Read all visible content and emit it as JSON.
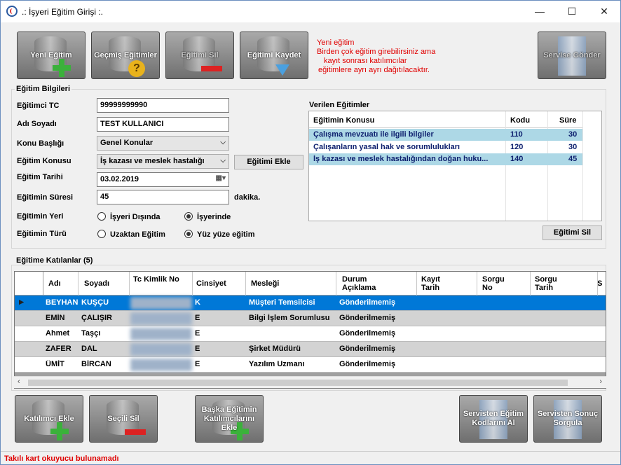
{
  "window": {
    "title": ".: İşyeri Eğitim Girişi :.",
    "minimize_icon": "minimize-icon",
    "maximize_icon": "maximize-icon",
    "close_icon": "close-icon"
  },
  "toolbar": {
    "new_training": "Yeni Eğitim",
    "past_trainings": "Geçmiş Eğitimler",
    "delete_training": "Eğitimi Sil",
    "save_training": "Eğitimi Kaydet",
    "send_service": "Servise Gönder"
  },
  "notice": {
    "line1": "Yeni eğitim",
    "line2": "Birden çok eğitim girebilirsiniz ama",
    "line3": "kayıt sonrası katılımcılar",
    "line4": "eğitimlere ayrı ayrı dağıtılacaktır."
  },
  "info": {
    "group_title": "Eğitim Bilgileri",
    "trainer_tc_label": "Eğitimci TC",
    "trainer_tc_value": "99999999990",
    "name_label": "Adı Soyadı",
    "name_value": "TEST KULLANICI",
    "topic_header_label": "Konu Başlığı",
    "topic_header_value": "Genel Konular",
    "topic_label": "Eğitim Konusu",
    "topic_value": "İş kazası ve meslek hastalığı",
    "add_training_button": "Eğitimi Ekle",
    "date_label": "Eğitim Tarihi",
    "date_value": "03.02.2019",
    "duration_label": "Eğitimin Süresi",
    "duration_value": "45",
    "duration_unit": "dakika.",
    "place_label": "Eğitimin Yeri",
    "place_option1": "İşyeri Dışında",
    "place_option2": "İşyerinde",
    "place_selected": "İşyerinde",
    "type_label": "Eğitimin Türü",
    "type_option1": "Uzaktan Eğitim",
    "type_option2": "Yüz yüze eğitim",
    "type_selected": "Yüz yüze eğitim"
  },
  "given": {
    "title": "Verilen Eğitimler",
    "headers": [
      "Eğitimin Konusu",
      "Kodu",
      "Süre"
    ],
    "rows": [
      [
        "Çalışma mevzuatı ile ilgili bilgiler",
        "110",
        "30"
      ],
      [
        "Çalışanların yasal hak ve sorumlulukları",
        "120",
        "30"
      ],
      [
        "İş kazası ve meslek hastalığından doğan huku...",
        "140",
        "45"
      ]
    ],
    "delete_button": "Eğitimi Sil"
  },
  "participants": {
    "title": "Eğitime Katılanlar (5)",
    "headers": [
      "Adı",
      "Soyadı",
      "Tc Kimlik No",
      "Cinsiyet",
      "Mesleği",
      "Durum Açıklama",
      "Kayıt Tarih",
      "Sorgu No",
      "Sorgu Tarih",
      "S"
    ],
    "rows": [
      [
        "BEYHAN",
        "KUŞÇU",
        "K",
        "Müşteri Temsilcisi",
        "Gönderilmemiş"
      ],
      [
        "EMİN",
        "ÇALIŞIR",
        "E",
        "Bilgi İşlem Sorumlusu",
        "Gönderilmemiş"
      ],
      [
        "Ahmet",
        "Taşçı",
        "E",
        "",
        "Gönderilmemiş"
      ],
      [
        "ZAFER",
        "DAL",
        "E",
        "Şirket Müdürü",
        "Gönderilmemiş"
      ],
      [
        "ÜMİT",
        "BİRCAN",
        "E",
        "Yazılım Uzmanı",
        "Gönderilmemiş"
      ]
    ]
  },
  "bottom": {
    "add_participant": "Katılımcı Ekle",
    "delete_selected": "Seçili Sil",
    "add_other": "Başka Eğitimin Katılımcılarını Ekle",
    "get_codes": "Servisten Eğitim Kodlarını Al",
    "query_results": "Servisten Sonuç Sorgula"
  },
  "status": "Takılı kart okuyucu bulunamadı"
}
